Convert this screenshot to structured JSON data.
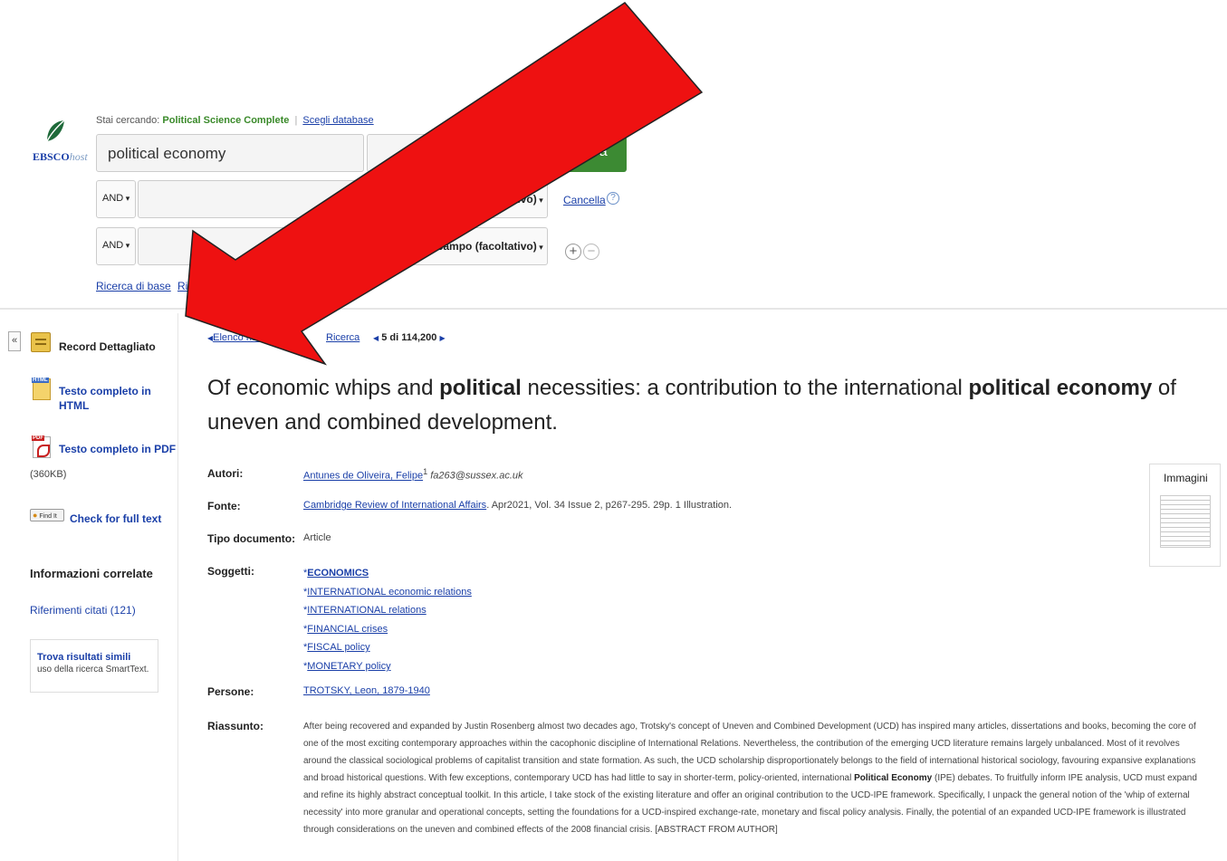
{
  "header": {
    "logo_text": "EBSCO",
    "logo_suffix": "host",
    "searching_prefix": "Stai cercando:",
    "database_name": "Political Science Complete",
    "choose_db_link": "Scegli database",
    "search_query": "political economy",
    "search_button": "Cerca",
    "bool_op_1": "AND",
    "bool_op_2": "AND",
    "field_select_1": "Seleziona un campo (facoltativo)",
    "field_select_2": "Seleziona un campo (facoltativo)",
    "clear_link": "Cancella",
    "basic_search": "Ricerca di base",
    "advanced_search": "Ricerca avanzata"
  },
  "sidebar": {
    "collapse": "«",
    "record_detail": "Record Dettagliato",
    "full_text_html": "Testo completo in HTML",
    "full_text_pdf": "Testo completo in PDF",
    "pdf_size": "(360KB)",
    "find_it": "Find It",
    "check_full_text": "Check for full text",
    "related_heading": "Informazioni correlate",
    "cited_refs": "Riferimenti citati (121)",
    "similar_title": "Trova risultati simili",
    "similar_desc": "uso della ricerca SmartText."
  },
  "record": {
    "nav_results": "Elenco risultati",
    "nav_refine": "Ricerca",
    "nav_position": "5 di 114,200",
    "title_parts": [
      "Of economic whips and ",
      "political",
      " necessities: a contribution to the international ",
      "political economy",
      " of uneven and combined development."
    ],
    "labels": {
      "authors": "Autori:",
      "source": "Fonte:",
      "doc_type": "Tipo documento:",
      "subjects": "Soggetti:",
      "people": "Persone:",
      "abstract": "Riassunto:"
    },
    "author_name": "Antunes de Oliveira, Felipe",
    "author_sup": "1",
    "author_email": "fa263@sussex.ac.uk",
    "source_title": "Cambridge Review of International Affairs",
    "source_details": ". Apr2021, Vol. 34 Issue 2, p267-295. 29p. 1 Illustration.",
    "doc_type": "Article",
    "subjects": [
      "ECONOMICS",
      "INTERNATIONAL economic relations",
      "INTERNATIONAL relations",
      "FINANCIAL crises",
      "FISCAL policy",
      "MONETARY policy"
    ],
    "people": "TROTSKY, Leon, 1879-1940",
    "abstract_before": "After being recovered and expanded by Justin Rosenberg almost two decades ago, Trotsky's concept of Uneven and Combined Development (UCD) has inspired many articles, dissertations and books, becoming the core of one of the most exciting contemporary approaches within the cacophonic discipline of International Relations. Nevertheless, the contribution of the emerging UCD literature remains largely unbalanced. Most of it revolves around the classical sociological problems of capitalist transition and state formation. As such, the UCD scholarship disproportionately belongs to the field of international historical sociology, favouring expansive explanations and broad historical questions. With few exceptions, contemporary UCD has had little to say in shorter-term, policy-oriented, international ",
    "abstract_bold": "Political Economy",
    "abstract_after": " (IPE) debates. To fruitfully inform IPE analysis, UCD must expand and refine its highly abstract conceptual toolkit. In this article, I take stock of the existing literature and offer an original contribution to the UCD-IPE framework. Specifically, I unpack the general notion of the 'whip of external necessity' into more granular and operational concepts, setting the foundations for a UCD-inspired exchange-rate, monetary and fiscal policy analysis. Finally, the potential of an expanded UCD-IPE framework is illustrated through considerations on the uneven and combined effects of the 2008 financial crisis. [ABSTRACT FROM AUTHOR]",
    "images_label": "Immagini"
  },
  "overlay": {
    "arrow_color": "#ee1111",
    "arrow_outline": "#222222"
  }
}
